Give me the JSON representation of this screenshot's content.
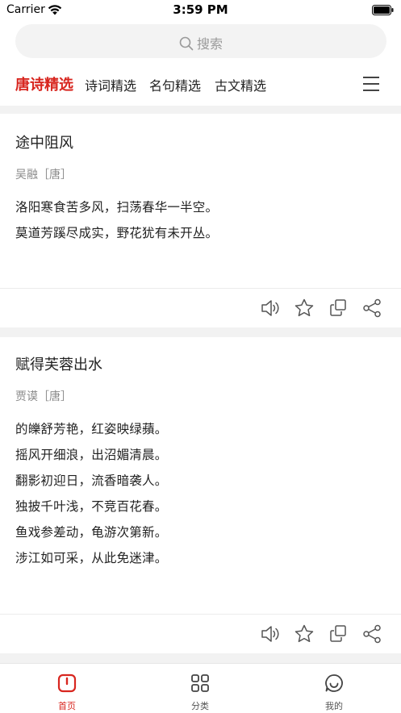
{
  "status": {
    "carrier": "Carrier",
    "time": "3:59 PM"
  },
  "search": {
    "placeholder": "搜索"
  },
  "tabs": [
    {
      "label": "唐诗精选",
      "active": true
    },
    {
      "label": "诗词精选"
    },
    {
      "label": "名句精选"
    },
    {
      "label": "古文精选"
    }
  ],
  "poems": [
    {
      "title": "途中阻风",
      "author": "吴融［唐］",
      "lines": [
        "洛阳寒食苦多风，扫荡春华一半空。",
        "莫道芳蹊尽成实，野花犹有未开丛。"
      ]
    },
    {
      "title": "赋得芙蓉出水",
      "author": "贾谟［唐］",
      "lines": [
        "的皪舒芳艳，红姿映绿蘋。",
        "摇风开细浪，出沼媚清晨。",
        "翻影初迎日，流香暗袭人。",
        "独披千叶浅，不竞百花春。",
        "鱼戏参差动，龟游次第新。",
        "涉江如可采，从此免迷津。"
      ]
    }
  ],
  "tabbar": [
    {
      "label": "首页",
      "icon": "book-icon",
      "active": true
    },
    {
      "label": "分类",
      "icon": "grid-icon"
    },
    {
      "label": "我的",
      "icon": "smile-icon"
    }
  ],
  "colors": {
    "accent": "#d8261f",
    "background": "#f2f2f2"
  }
}
